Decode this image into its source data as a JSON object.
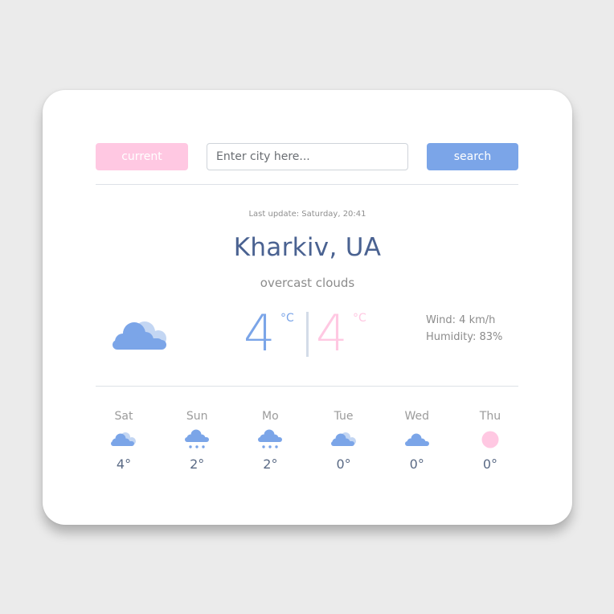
{
  "search": {
    "current_label": "current",
    "input_value": "",
    "input_placeholder": "Enter city here...",
    "search_label": "search"
  },
  "weather": {
    "last_update": "Last update: Saturday, 20:41",
    "city": "Kharkiv, UA",
    "description": "overcast clouds",
    "icon": "cloud-icon",
    "temp_celsius": "4",
    "temp_celsius_unit": "°C",
    "temp_alt": "4",
    "temp_alt_unit": "°C",
    "wind": "Wind: 4 km/h",
    "humidity": "Humidity: 83%"
  },
  "colors": {
    "accent_blue": "#7ba5e8",
    "accent_pink": "#ffc8e2",
    "city_text": "#4a6291"
  },
  "forecast": [
    {
      "day": "Sat",
      "icon": "broken-clouds-icon",
      "temp": "4°"
    },
    {
      "day": "Sun",
      "icon": "snow-icon",
      "temp": "2°"
    },
    {
      "day": "Mo",
      "icon": "snow-icon",
      "temp": "2°"
    },
    {
      "day": "Tue",
      "icon": "broken-clouds-icon",
      "temp": "0°"
    },
    {
      "day": "Wed",
      "icon": "cloud-icon",
      "temp": "0°"
    },
    {
      "day": "Thu",
      "icon": "sun-icon",
      "temp": "0°"
    }
  ]
}
